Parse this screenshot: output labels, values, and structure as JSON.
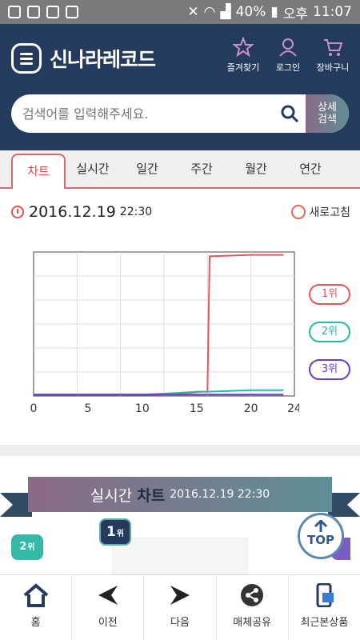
{
  "statusbar": {
    "battery": "40%",
    "ampm": "오후",
    "time": "11:07"
  },
  "header": {
    "brand": "신나라레코드",
    "icons": [
      {
        "name": "star-icon",
        "label": "즐겨찾기"
      },
      {
        "name": "user-icon",
        "label": "로그인"
      },
      {
        "name": "cart-icon",
        "label": "장바구니"
      }
    ]
  },
  "search": {
    "placeholder": "검색어를 입력해주세요.",
    "detail_label": "상세\n검색"
  },
  "tabs": [
    "차트",
    "실시간",
    "일간",
    "주간",
    "월간",
    "연간"
  ],
  "datebar": {
    "date": "2016.12.19",
    "time": "22:30",
    "refresh": "새로고침"
  },
  "chart_data": {
    "type": "line",
    "xlim": [
      0,
      24
    ],
    "xticks": [
      0,
      5,
      10,
      15,
      20,
      24
    ],
    "ylim": [
      0,
      100
    ],
    "grid": true,
    "series": [
      {
        "name": "1위",
        "color": "#e05a5a",
        "x": [
          0,
          5,
          10,
          12,
          14,
          15.5,
          16,
          16.2,
          20,
          23
        ],
        "y": [
          1,
          1,
          1,
          1,
          2,
          3,
          3,
          97,
          98,
          98
        ]
      },
      {
        "name": "2위",
        "color": "#29b7a8",
        "x": [
          0,
          5,
          10,
          13,
          15,
          16,
          20,
          23
        ],
        "y": [
          1,
          1,
          1,
          2,
          3,
          3,
          4,
          4
        ]
      },
      {
        "name": "3위",
        "color": "#6a3fc4",
        "x": [
          0,
          5,
          10,
          15,
          20,
          23
        ],
        "y": [
          1,
          1,
          1,
          1,
          1,
          1
        ]
      }
    ]
  },
  "banner": {
    "label_a": "실시간",
    "label_b": "차트",
    "datetime": "2016.12.19 22:30"
  },
  "ranks": {
    "r1": "1",
    "r2": "2",
    "suffix": "위"
  },
  "top_button": "TOP",
  "bottomnav": [
    "홈",
    "이전",
    "다음",
    "매체공유",
    "최근본상품"
  ],
  "colors": {
    "header": "#243b5e",
    "accent": "#d64b4b",
    "teal": "#29b7a8",
    "purple": "#6a3fc4"
  }
}
